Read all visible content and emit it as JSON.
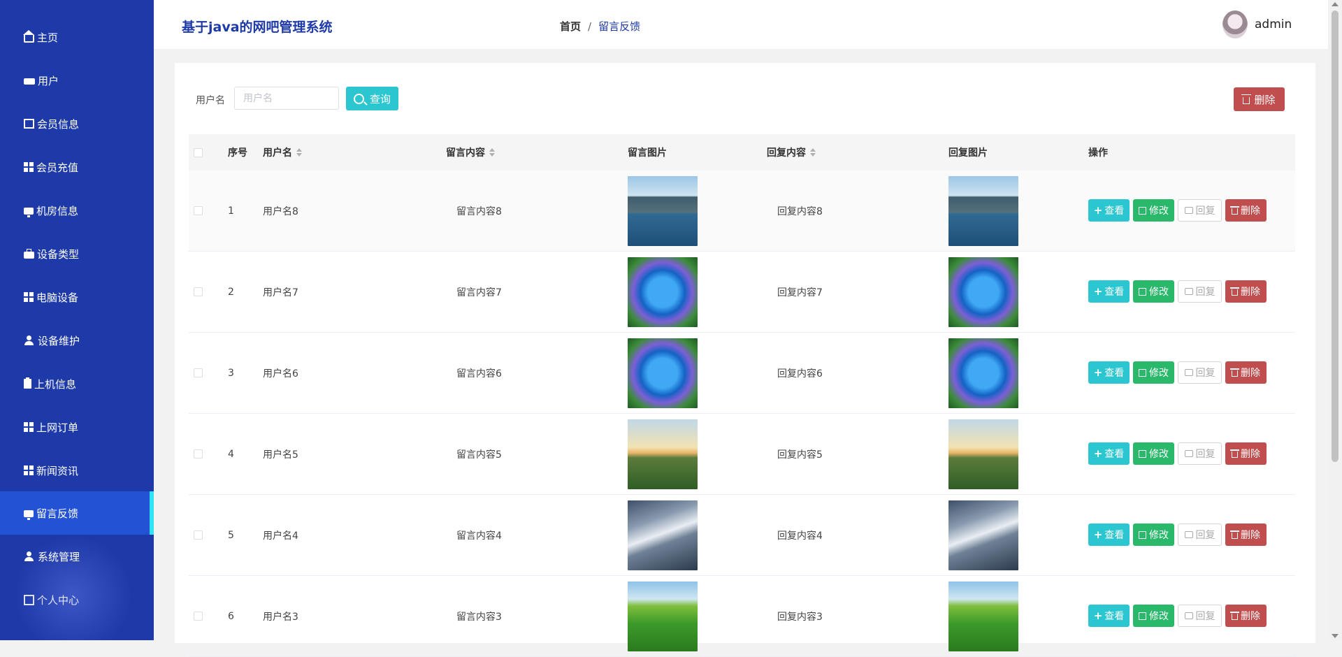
{
  "app": {
    "title": "基于java的网吧管理系统"
  },
  "sidebar": {
    "items": [
      {
        "label": "主页",
        "icon": "home-icon"
      },
      {
        "label": "用户",
        "icon": "ticket-icon"
      },
      {
        "label": "会员信息",
        "icon": "chart-icon"
      },
      {
        "label": "会员充值",
        "icon": "grid-icon"
      },
      {
        "label": "机房信息",
        "icon": "monitor-icon"
      },
      {
        "label": "设备类型",
        "icon": "briefcase-icon"
      },
      {
        "label": "电脑设备",
        "icon": "grid-icon"
      },
      {
        "label": "设备维护",
        "icon": "user-icon"
      },
      {
        "label": "上机信息",
        "icon": "clipboard-icon"
      },
      {
        "label": "上网订单",
        "icon": "grid-icon"
      },
      {
        "label": "新闻资讯",
        "icon": "grid-icon"
      },
      {
        "label": "留言反馈",
        "icon": "monitor-icon",
        "active": true
      },
      {
        "label": "系统管理",
        "icon": "user-icon"
      },
      {
        "label": "个人中心",
        "icon": "card-icon"
      }
    ]
  },
  "header": {
    "breadcrumb": {
      "home": "首页",
      "separator": "/",
      "current": "留言反馈"
    },
    "user": {
      "name": "admin"
    }
  },
  "search": {
    "label": "用户名",
    "placeholder": "用户名",
    "value": "",
    "button_label": "查询"
  },
  "toolbar": {
    "delete_label": "删除"
  },
  "table": {
    "columns": {
      "index": "序号",
      "username": "用户名",
      "content": "留言内容",
      "image": "留言图片",
      "reply": "回复内容",
      "reply_image": "回复图片",
      "actions": "操作"
    },
    "rows": [
      {
        "index": "1",
        "username": "用户名8",
        "content": "留言内容8",
        "image": "lake-mountain",
        "reply": "回复内容8",
        "reply_image": "lake-mountain"
      },
      {
        "index": "2",
        "username": "用户名7",
        "content": "留言内容7",
        "image": "heart-lake",
        "reply": "回复内容7",
        "reply_image": "heart-lake"
      },
      {
        "index": "3",
        "username": "用户名6",
        "content": "留言内容6",
        "image": "heart-lake",
        "reply": "回复内容6",
        "reply_image": "heart-lake"
      },
      {
        "index": "4",
        "username": "用户名5",
        "content": "留言内容5",
        "image": "sunrise-field",
        "reply": "回复内容5",
        "reply_image": "sunrise-field"
      },
      {
        "index": "5",
        "username": "用户名4",
        "content": "留言内容4",
        "image": "snow-mountain",
        "reply": "回复内容4",
        "reply_image": "snow-mountain"
      },
      {
        "index": "6",
        "username": "用户名3",
        "content": "留言内容3",
        "image": "green-hills",
        "reply": "回复内容3",
        "reply_image": "green-hills"
      }
    ],
    "actions": {
      "view": "查看",
      "edit": "修改",
      "reply": "回复",
      "delete": "删除"
    }
  },
  "colors": {
    "sidebar": "#1e3aa8",
    "active": "#2452d4",
    "accent": "#2bc6cf",
    "success": "#2ab86a",
    "danger": "#c14e4e"
  }
}
